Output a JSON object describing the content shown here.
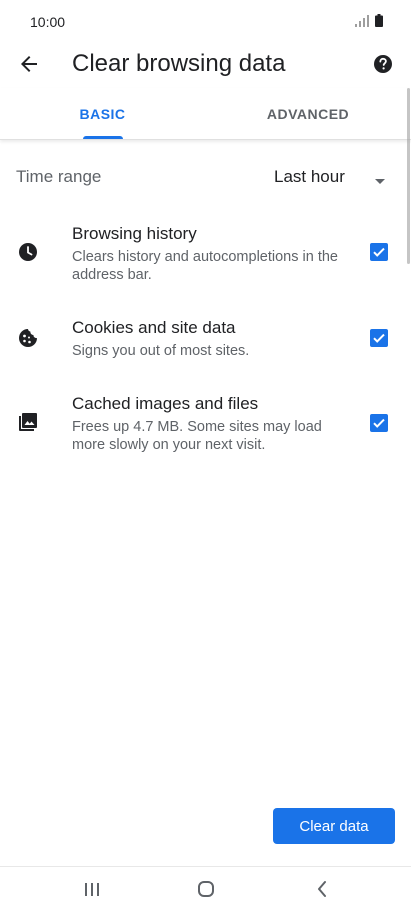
{
  "status_bar": {
    "time": "10:00",
    "icons": [
      "signal-icon",
      "battery-icon"
    ]
  },
  "app_bar": {
    "title": "Clear browsing data",
    "back_icon": "arrow-back-icon",
    "help_icon": "help-icon"
  },
  "tabs": [
    {
      "label": "BASIC",
      "selected": true
    },
    {
      "label": "ADVANCED",
      "selected": false
    }
  ],
  "time_range": {
    "label": "Time range",
    "value": "Last hour"
  },
  "options": [
    {
      "icon": "clock-icon",
      "title": "Browsing history",
      "description": "Clears history and autocompletions in the address bar.",
      "checked": true
    },
    {
      "icon": "cookie-icon",
      "title": "Cookies and site data",
      "description": "Signs you out of most sites.",
      "checked": true
    },
    {
      "icon": "image-icon",
      "title": "Cached images and files",
      "description": "Frees up 4.7 MB. Some sites may load more slowly on your next visit.",
      "checked": true
    }
  ],
  "clear_button": {
    "label": "Clear data"
  },
  "colors": {
    "accent": "#1a73e8",
    "text_primary": "#202124",
    "text_secondary": "#5f6368"
  },
  "nav_bar": {
    "icons": [
      "recent-apps-icon",
      "home-icon",
      "back-nav-icon"
    ]
  }
}
